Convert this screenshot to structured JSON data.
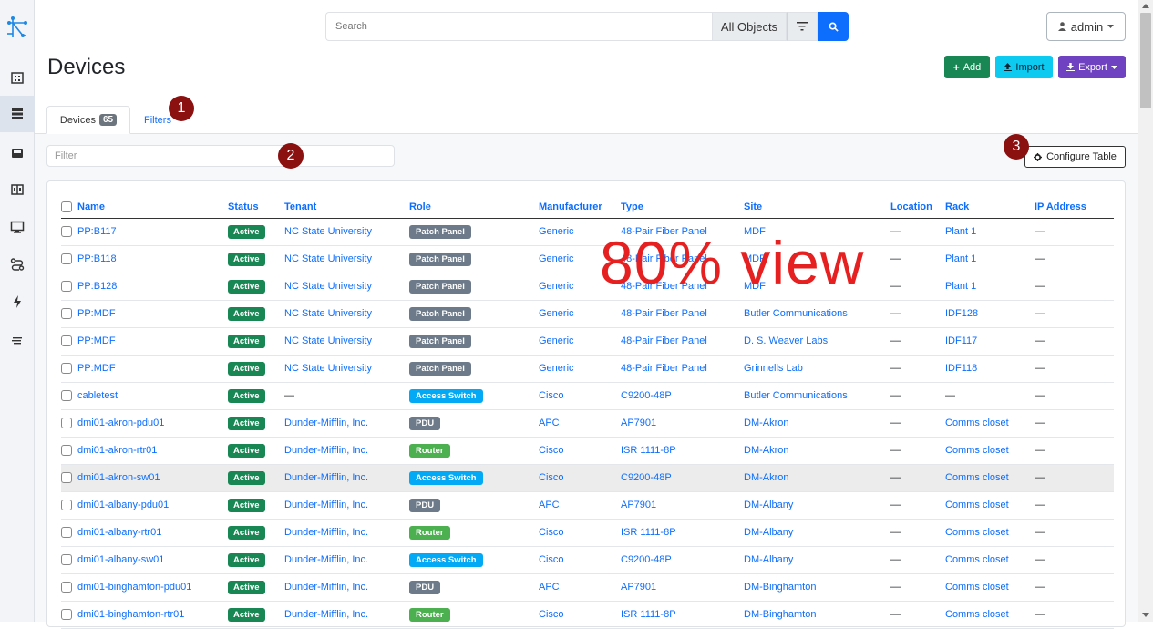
{
  "app": {
    "title": "Devices"
  },
  "search": {
    "placeholder": "Search",
    "scope": "All Objects"
  },
  "user": {
    "name": "admin"
  },
  "actions": {
    "add": "Add",
    "import": "Import",
    "export": "Export"
  },
  "tabs": {
    "devices_label": "Devices",
    "devices_count": "65",
    "filters_label": "Filters"
  },
  "filter": {
    "placeholder": "Filter"
  },
  "configure": {
    "label": "Configure Table"
  },
  "markers": [
    "1",
    "2",
    "3"
  ],
  "watermark": "80% view",
  "sidebar": {
    "icons": [
      "building-icon",
      "server-rack-icon",
      "rack-icon",
      "patch-panel-icon",
      "monitor-icon",
      "cable-icon",
      "power-icon",
      "menu-lines-icon"
    ]
  },
  "table": {
    "columns": [
      "Name",
      "Status",
      "Tenant",
      "Role",
      "Manufacturer",
      "Type",
      "Site",
      "Location",
      "Rack",
      "IP Address"
    ],
    "role_colors": {
      "Patch Panel": "#6c7a89",
      "Access Switch": "#03a9f4",
      "PDU": "#6c7a89",
      "Router": "#4caf50"
    },
    "rows": [
      [
        "PP:B117",
        "Active",
        "NC State University",
        "Patch Panel",
        "Generic",
        "48-Pair Fiber Panel",
        "MDF",
        "—",
        "Plant 1",
        "—"
      ],
      [
        "PP:B118",
        "Active",
        "NC State University",
        "Patch Panel",
        "Generic",
        "48-Pair Fiber Panel",
        "MDF",
        "—",
        "Plant 1",
        "—"
      ],
      [
        "PP:B128",
        "Active",
        "NC State University",
        "Patch Panel",
        "Generic",
        "48-Pair Fiber Panel",
        "MDF",
        "—",
        "Plant 1",
        "—"
      ],
      [
        "PP:MDF",
        "Active",
        "NC State University",
        "Patch Panel",
        "Generic",
        "48-Pair Fiber Panel",
        "Butler Communications",
        "—",
        "IDF128",
        "—"
      ],
      [
        "PP:MDF",
        "Active",
        "NC State University",
        "Patch Panel",
        "Generic",
        "48-Pair Fiber Panel",
        "D. S. Weaver Labs",
        "—",
        "IDF117",
        "—"
      ],
      [
        "PP:MDF",
        "Active",
        "NC State University",
        "Patch Panel",
        "Generic",
        "48-Pair Fiber Panel",
        "Grinnells Lab",
        "—",
        "IDF118",
        "—"
      ],
      [
        "cabletest",
        "Active",
        "—",
        "Access Switch",
        "Cisco",
        "C9200-48P",
        "Butler Communications",
        "—",
        "—",
        "—"
      ],
      [
        "dmi01-akron-pdu01",
        "Active",
        "Dunder-Mifflin, Inc.",
        "PDU",
        "APC",
        "AP7901",
        "DM-Akron",
        "—",
        "Comms closet",
        "—"
      ],
      [
        "dmi01-akron-rtr01",
        "Active",
        "Dunder-Mifflin, Inc.",
        "Router",
        "Cisco",
        "ISR 1111-8P",
        "DM-Akron",
        "—",
        "Comms closet",
        "—"
      ],
      [
        "dmi01-akron-sw01",
        "Active",
        "Dunder-Mifflin, Inc.",
        "Access Switch",
        "Cisco",
        "C9200-48P",
        "DM-Akron",
        "—",
        "Comms closet",
        "—"
      ],
      [
        "dmi01-albany-pdu01",
        "Active",
        "Dunder-Mifflin, Inc.",
        "PDU",
        "APC",
        "AP7901",
        "DM-Albany",
        "—",
        "Comms closet",
        "—"
      ],
      [
        "dmi01-albany-rtr01",
        "Active",
        "Dunder-Mifflin, Inc.",
        "Router",
        "Cisco",
        "ISR 1111-8P",
        "DM-Albany",
        "—",
        "Comms closet",
        "—"
      ],
      [
        "dmi01-albany-sw01",
        "Active",
        "Dunder-Mifflin, Inc.",
        "Access Switch",
        "Cisco",
        "C9200-48P",
        "DM-Albany",
        "—",
        "Comms closet",
        "—"
      ],
      [
        "dmi01-binghamton-pdu01",
        "Active",
        "Dunder-Mifflin, Inc.",
        "PDU",
        "APC",
        "AP7901",
        "DM-Binghamton",
        "—",
        "Comms closet",
        "—"
      ],
      [
        "dmi01-binghamton-rtr01",
        "Active",
        "Dunder-Mifflin, Inc.",
        "Router",
        "Cisco",
        "ISR 1111-8P",
        "DM-Binghamton",
        "—",
        "Comms closet",
        "—"
      ]
    ]
  }
}
